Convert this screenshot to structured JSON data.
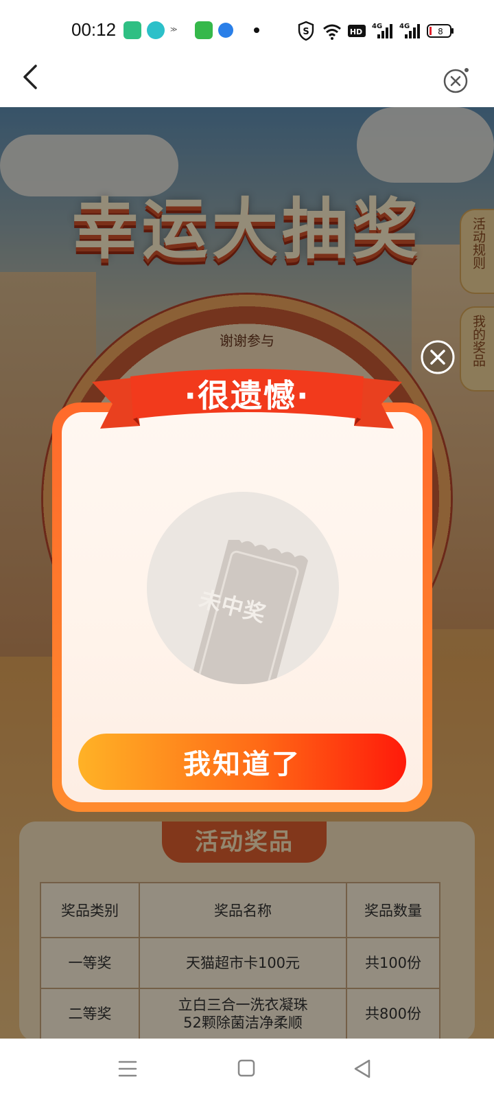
{
  "status_bar": {
    "time": "00:12",
    "battery_level": "8",
    "icons": [
      "app-icon",
      "chat-icon",
      "network-speed-icon",
      "message-icon",
      "browser-icon",
      "shield-icon",
      "wifi-icon",
      "hd-icon",
      "signal-4g-icon",
      "signal-4g-icon",
      "battery-icon"
    ]
  },
  "header": {
    "back_icon": "chevron-left-icon",
    "close_icon": "close-circle-icon"
  },
  "page": {
    "banner_title": "幸运大抽奖",
    "wheel_segment": "谢谢参与",
    "side_tabs": [
      "活动规则",
      "我的奖品"
    ],
    "prizes_section_title": "活动奖品",
    "prize_table": {
      "headers": [
        "奖品类别",
        "奖品名称",
        "奖品数量"
      ],
      "rows": [
        [
          "一等奖",
          "天猫超市卡100元",
          "共100份"
        ],
        [
          "二等奖",
          "立白三合一洗衣凝珠 52颗除菌洁净柔顺",
          "共800份"
        ]
      ]
    }
  },
  "modal": {
    "title": "·很遗憾·",
    "result_text": "未中奖",
    "confirm_label": "我知道了",
    "close_icon": "close-icon"
  },
  "nav_bar": {
    "icons": [
      "menu-icon",
      "home-square-icon",
      "back-triangle-icon"
    ]
  },
  "colors": {
    "modal_frame": "#ff6a2b",
    "button_start": "#ffb226",
    "button_end": "#ff1a0a",
    "ribbon": "#f23a1c"
  }
}
